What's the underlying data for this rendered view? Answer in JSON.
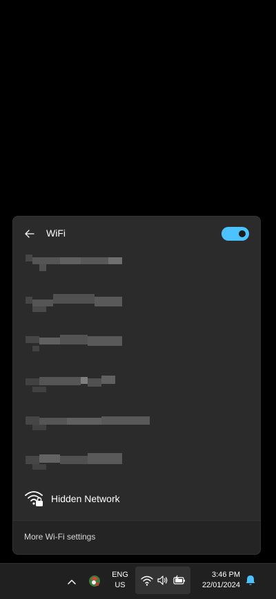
{
  "flyout": {
    "title": "WiFi",
    "back_icon": "arrow-left-icon",
    "wifi_toggle": {
      "state": "on",
      "accent_color": "#4cc2ff"
    },
    "networks": [
      {
        "name": "",
        "obscured": true
      },
      {
        "name": "",
        "obscured": true
      },
      {
        "name": "",
        "obscured": true
      },
      {
        "name": "",
        "obscured": true
      },
      {
        "name": "",
        "obscured": true
      },
      {
        "name": "",
        "obscured": true
      }
    ],
    "hidden_network": {
      "label": "Hidden Network",
      "icon": "wifi-lock-icon"
    },
    "footer_link": "More Wi-Fi settings"
  },
  "taskbar": {
    "chevron_icon": "chevron-up-icon",
    "app_icon": "app-tray-icon",
    "language": {
      "line1": "ENG",
      "line2": "US"
    },
    "quick_settings": {
      "icons": [
        "wifi-icon",
        "speaker-icon",
        "battery-charging-icon"
      ]
    },
    "clock": {
      "time": "3:46 PM",
      "date": "22/01/2024"
    },
    "notification_icon": "bell-icon",
    "accent_color": "#4cc2ff"
  }
}
